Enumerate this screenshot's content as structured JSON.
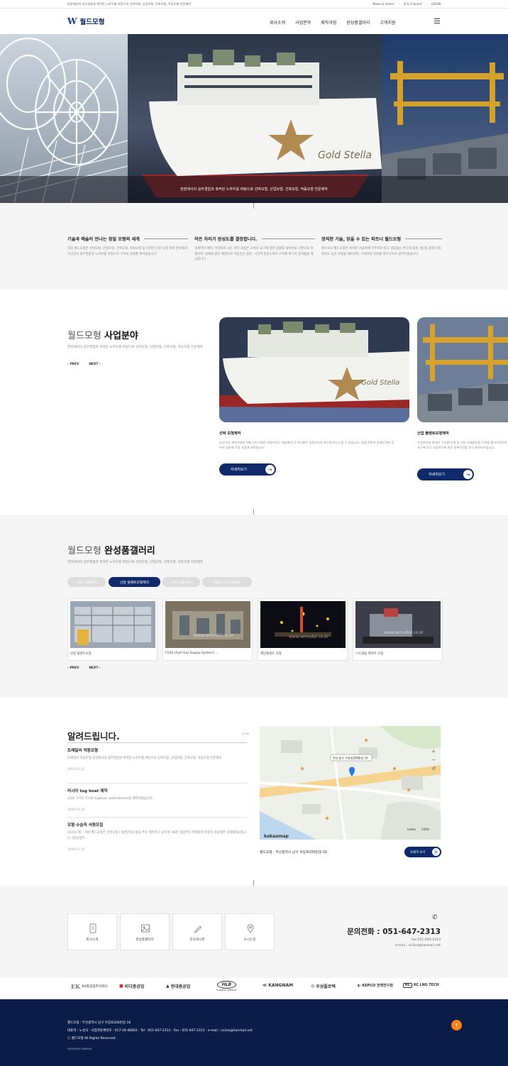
{
  "topbar": {
    "tagline": "현장에서의 실무경험과 축적된 노하우를 바탕으로 선박모형, 산업모형, 건축모형, 작동모형 전문제작",
    "links": [
      "News & notice",
      "Q & A board",
      "LOGIN"
    ]
  },
  "header": {
    "logo_mark": "W",
    "logo_text": "월드모형",
    "nav": [
      "회사소개",
      "사업분야",
      "제작과정",
      "완성품갤러리",
      "고객지원"
    ]
  },
  "hero": {
    "caption": "현장에서의 실무경험과 축적된 노하우를 바탕으로 선박모형, 산업모형, 건축모형, 작동모형 전문제작",
    "ship_name": "Gold Stella"
  },
  "intro": [
    {
      "title": "기술과 예술이 만나는 정밀 모형의 세계",
      "body": "저희 월드모형은 선박모형, 산업모형, 건축모형, 작동모형 등 다양한 전문 모형 제작 분야에서 수년간의 실무경험과 노하우를 바탕으로 고객의 신뢰를 쌓아왔습니다."
    },
    {
      "title": "작은 차이가 완성도를 결정합니다.",
      "body": "설계부터 제작, 마감까지 모든 제작 과정은 고객의 요구에 맞춘 맞춤형 솔루션을 기반으로 진행되며, 실제와 같은 재현력과 작동성은 물론, 시각적 완성도까지 고려해 최고의 결과물을 제공합니다."
    },
    {
      "title": "정직한 기술, 믿을 수 있는 파트너 월드모형",
      "body": "앞으로도 월드모형은 축적된 기술력에 안주하지 않고 끊임없는 연구와 품질 개선을 통해 더욱 완성도 높은 모형을 제작하며, 고객과의 신뢰를 최우선으로 생각하겠습니다."
    }
  ],
  "business": {
    "title_light": "월드모형",
    "title_bold": "사업분야",
    "desc": "현장에서의 실무경험과 축적된 노하우를 바탕으로 선박모형, 산업모형, 건축모형, 작동모형 전문제작",
    "prev": "PREV",
    "next": "NEXT",
    "cards": [
      {
        "title": "선박 모형제작",
        "desc": "조선사의 계약이래에 억배 1개 단위로 만들어지는 세상에서 단 하나뿐인 실질가치의 축소판이라고 할 수 있습니다. 실제 선박의 설계도면에 준하여 실물에 가장 가깝게 제작됩니다.",
        "button": "자세히보기"
      },
      {
        "title": "산업 플랜트모형제작",
        "desc": "산업현장에 필요한 구조물(기계 및 기타 시제품등을 도면을 클라이언트의 요구에 적극 부합하도록 현장 실측시진을 적극 제작되어집니다.",
        "button": "자세히보기"
      }
    ]
  },
  "gallery": {
    "title_light": "월드모형",
    "title_bold": "완성품갤러리",
    "desc": "현장에서의 실무경험과 축적된 노하우를 바탕으로 선박모형, 산업모형, 건축모형, 작동모형 전문제작",
    "tabs": [
      "선박 모형제작",
      "산업 플랜트모형제작",
      "건축 모형제작",
      "작동/기타 모형제작"
    ],
    "items": [
      "산업 플랜트모형",
      "FGSS (Fuel Gas Supply System) ...",
      "해양플랜트 모형",
      "스트래들 캐리어 모형"
    ],
    "watermark": "www.wmodel.co.kr",
    "prev": "PREV",
    "next": "NEXT"
  },
  "notice": {
    "title": "알려드립니다.",
    "more": "MORE",
    "items": [
      {
        "title": "트레일러 작동모형",
        "body": "트레일러 작동모형 현장에서의 실무경험과 축적된 노하우를 바탕으로 선박모형, 산업모형, 건축모형, 작동모형 전문제작",
        "date": "2010-01-22"
      },
      {
        "title": "러시아 tug boat 제작",
        "body": "1/28 크기의 러시아 tugboat, waterstroom을 제작하였습니다.",
        "date": "2009-02-24"
      },
      {
        "title": "모형 수습직 사원모집",
        "body": "[회사소개] - 저희 월드모형은 선박모형 / 일반산업모형을 주로 제작하고 있으며, 90년 설립부터 현재까지 착실히 성장해온 모형제작사입니다. [담당업무...",
        "date": "2009-01-16"
      }
    ]
  },
  "map": {
    "address": "월드모형 : 부산광역시 남구 우암로200번길 16",
    "button": "자세히 보기",
    "marker_label": "부산 남구 우암로200번길 16",
    "brand": "kakaomap",
    "brand_small": "kakao",
    "scale": "100m"
  },
  "contact": {
    "boxes": [
      "회사소개",
      "완성품갤러리",
      "문의게시판",
      "오시는길"
    ],
    "phone_label": "문의전화 : 051-647-2313",
    "fax": "fax.051-645-2313",
    "email": "e-mail : no3ss@hanmail.net"
  },
  "partners": [
    "EK중공업주식회사",
    "비디중공업",
    "현대중공업",
    "HLB",
    "KANGNAM",
    "우성플로텍",
    "KEPCO 전력연구원",
    "KC LNG TECH"
  ],
  "partner_sub": "HYUNDAI LIFEBOAT",
  "footer": {
    "line1": "월드모형 : 부산광역시 남구 우암로200번길 16",
    "line2": "대표자 : 노성식  ·  사업자등록번호 : 617-26-46842  ·  Tel : 051-647-2313  ·  Fax : 051-647-2313  ·  e-mail : no3ss@hanmail.net",
    "copyright": "ⓒ 월드모형 All Rights Reserved.",
    "design": "DESIGN BY DAMKAR"
  },
  "colors": {
    "navy": "#0a1d48",
    "accent": "#0f2a6a",
    "orange": "#ff7d1a"
  }
}
